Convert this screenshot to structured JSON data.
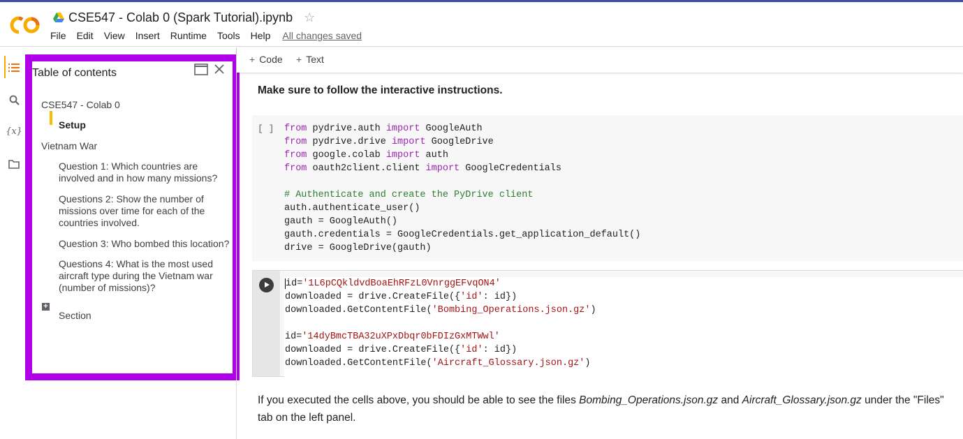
{
  "header": {
    "notebook_title": "CSE547 - Colab 0 (Spark Tutorial).ipynb",
    "menu": [
      "File",
      "Edit",
      "View",
      "Insert",
      "Runtime",
      "Tools",
      "Help"
    ],
    "save_status": "All changes saved"
  },
  "toolbar": {
    "code_label": "Code",
    "text_label": "Text"
  },
  "toc": {
    "title": "Table of contents",
    "items": [
      "CSE547 - Colab 0",
      "Setup",
      "Vietnam War",
      "Question 1: Which countries are involved and in how many missions?",
      "Questions 2: Show the number of missions over time for each of the countries involved.",
      "Question 3: Who bombed this location?",
      "Questions 4: What is the most used aircraft type during the Vietnam war (number of missions)?",
      "Section"
    ]
  },
  "notebook": {
    "instruction": "Make sure to follow the interactive instructions.",
    "cell1_prompt": "[ ]",
    "cell1_lines": [
      [
        [
          "kw",
          "from"
        ],
        [
          "t",
          " pydrive.auth "
        ],
        [
          "kw",
          "import"
        ],
        [
          "t",
          " GoogleAuth"
        ]
      ],
      [
        [
          "kw",
          "from"
        ],
        [
          "t",
          " pydrive.drive "
        ],
        [
          "kw",
          "import"
        ],
        [
          "t",
          " GoogleDrive"
        ]
      ],
      [
        [
          "kw",
          "from"
        ],
        [
          "t",
          " google.colab "
        ],
        [
          "kw",
          "import"
        ],
        [
          "t",
          " auth"
        ]
      ],
      [
        [
          "kw",
          "from"
        ],
        [
          "t",
          " oauth2client.client "
        ],
        [
          "kw",
          "import"
        ],
        [
          "t",
          " GoogleCredentials"
        ]
      ],
      [],
      [
        [
          "cm",
          "# Authenticate and create the PyDrive client"
        ]
      ],
      [
        [
          "t",
          "auth.authenticate_user()"
        ]
      ],
      [
        [
          "t",
          "gauth = GoogleAuth()"
        ]
      ],
      [
        [
          "t",
          "gauth.credentials = GoogleCredentials.get_application_default()"
        ]
      ],
      [
        [
          "t",
          "drive = GoogleDrive(gauth)"
        ]
      ]
    ],
    "cell2_lines": [
      [
        [
          "t",
          "id="
        ],
        [
          "st",
          "'1L6pCQkldvdBoaEhRFzL0VnrggEFvqON4'"
        ]
      ],
      [
        [
          "t",
          "downloaded = drive.CreateFile({"
        ],
        [
          "st",
          "'id'"
        ],
        [
          "t",
          ": id})"
        ]
      ],
      [
        [
          "t",
          "downloaded.GetContentFile("
        ],
        [
          "st",
          "'Bombing_Operations.json.gz'"
        ],
        [
          "t",
          ")"
        ]
      ],
      [],
      [
        [
          "t",
          "id="
        ],
        [
          "st",
          "'14dyBmcTBA32uXPxDbqr0bFDIzGxMTWwl'"
        ]
      ],
      [
        [
          "t",
          "downloaded = drive.CreateFile({"
        ],
        [
          "st",
          "'id'"
        ],
        [
          "t",
          ": id})"
        ]
      ],
      [
        [
          "t",
          "downloaded.GetContentFile("
        ],
        [
          "st",
          "'Aircraft_Glossary.json.gz'"
        ],
        [
          "t",
          ")"
        ]
      ]
    ],
    "para_parts": [
      "If you executed the cells above, you should be able to see the files ",
      "Bombing_Operations.json.gz",
      " and ",
      "Aircraft_Glossary.json.gz",
      " under the \"Files\" tab on the left panel."
    ]
  },
  "colors": {
    "accent_border": "#b000ea",
    "keyword": "#9c27b0",
    "comment": "#2e7d32",
    "string": "#a31515",
    "active_marker": "#fbbc04"
  },
  "icons": [
    "colab-logo-icon",
    "drive-icon",
    "star-icon",
    "toc-list-icon",
    "search-icon",
    "variables-icon",
    "folder-icon",
    "open-window-icon",
    "close-icon",
    "run-icon",
    "expand-plus-icon"
  ]
}
